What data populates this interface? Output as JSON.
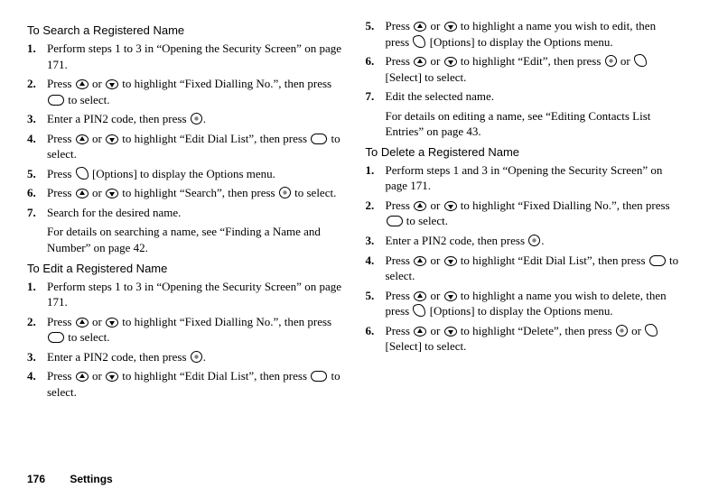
{
  "left": {
    "search": {
      "title": "To Search a Registered Name",
      "steps": [
        "Perform steps 1 to 3 in “Opening the Security Screen” on page 171.",
        "Press {up} or {down} to highlight “Fixed Dialling No.”, then press {center} to select.",
        "Enter a PIN2 code, then press {circle}.",
        "Press {up} or {down} to highlight “Edit Dial List”, then press {center} to select.",
        "Press {soft} [Options] to display the Options menu.",
        "Press {up} or {down} to highlight “Search”, then press {circle} to select.",
        "Search for the desired name."
      ],
      "note": "For details on searching a name, see “Finding a Name and Number” on page 42."
    },
    "edit": {
      "title": "To Edit a Registered Name",
      "steps": [
        "Perform steps 1 to 3 in “Opening the Security Screen” on page 171.",
        "Press {up} or {down} to highlight “Fixed Dialling No.”, then press {center} to select.",
        "Enter a PIN2 code, then press {circle}.",
        "Press {up} or {down} to highlight “Edit Dial List”, then press {center} to select."
      ]
    }
  },
  "right": {
    "edit_cont": {
      "start": 5,
      "steps": [
        "Press {up} or {down} to highlight a name you wish to edit, then press {soft} [Options] to display the Options menu.",
        "Press {up} or {down} to highlight “Edit”, then press {circle} or {soft} [Select] to select.",
        "Edit the selected name."
      ],
      "note": "For details on editing a name, see “Editing Contacts List Entries” on page 43."
    },
    "delete": {
      "title": "To Delete a Registered Name",
      "steps": [
        "Perform steps 1 and 3 in “Opening the Security Screen” on page 171.",
        "Press {up} or {down} to highlight “Fixed Dialling No.”, then press {center} to select.",
        "Enter a PIN2 code, then press {circle}.",
        "Press {up} or {down} to highlight “Edit Dial List”, then press {center} to select.",
        "Press {up} or {down} to highlight a name you wish to delete, then press {soft} [Options] to display the Options menu.",
        "Press {up} or {down} to highlight “Delete”, then press {circle} or {soft} [Select] to select."
      ]
    }
  },
  "footer": {
    "page": "176",
    "section": "Settings"
  }
}
